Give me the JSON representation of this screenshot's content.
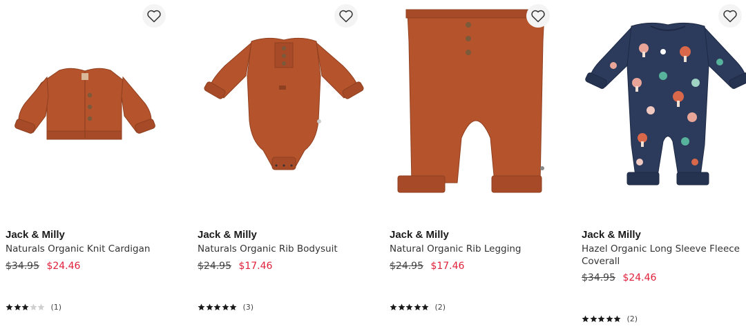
{
  "products": [
    {
      "brand": "Jack & Milly",
      "name": "Naturals Organic Knit Cardigan",
      "price_original": "$34.95",
      "price_sale": "$24.46",
      "rating": 3,
      "rating_max": 5,
      "review_count": "(1)",
      "image_icon": "knit-cardigan",
      "wishlist_icon": "heart-outline-icon"
    },
    {
      "brand": "Jack & Milly",
      "name": "Naturals Organic Rib Bodysuit",
      "price_original": "$24.95",
      "price_sale": "$17.46",
      "rating": 5,
      "rating_max": 5,
      "review_count": "(3)",
      "image_icon": "rib-bodysuit",
      "wishlist_icon": "heart-outline-icon"
    },
    {
      "brand": "Jack & Milly",
      "name": "Natural Organic Rib Legging",
      "price_original": "$24.95",
      "price_sale": "$17.46",
      "rating": 5,
      "rating_max": 5,
      "review_count": "(2)",
      "image_icon": "rib-legging",
      "wishlist_icon": "heart-outline-icon"
    },
    {
      "brand": "Jack & Milly",
      "name": "Hazel Organic Long Sleeve Fleece Coverall",
      "price_original": "$34.95",
      "price_sale": "$24.46",
      "rating": 5,
      "rating_max": 5,
      "review_count": "(2)",
      "image_icon": "floral-coverall",
      "wishlist_icon": "heart-outline-icon"
    }
  ],
  "colors": {
    "rust": "#b5532c",
    "rust_dark": "#9a4423",
    "navy": "#2c3a5c",
    "sale_red": "#e0203a",
    "star": "#1a1a1a",
    "star_empty": "#cfcfcf"
  }
}
